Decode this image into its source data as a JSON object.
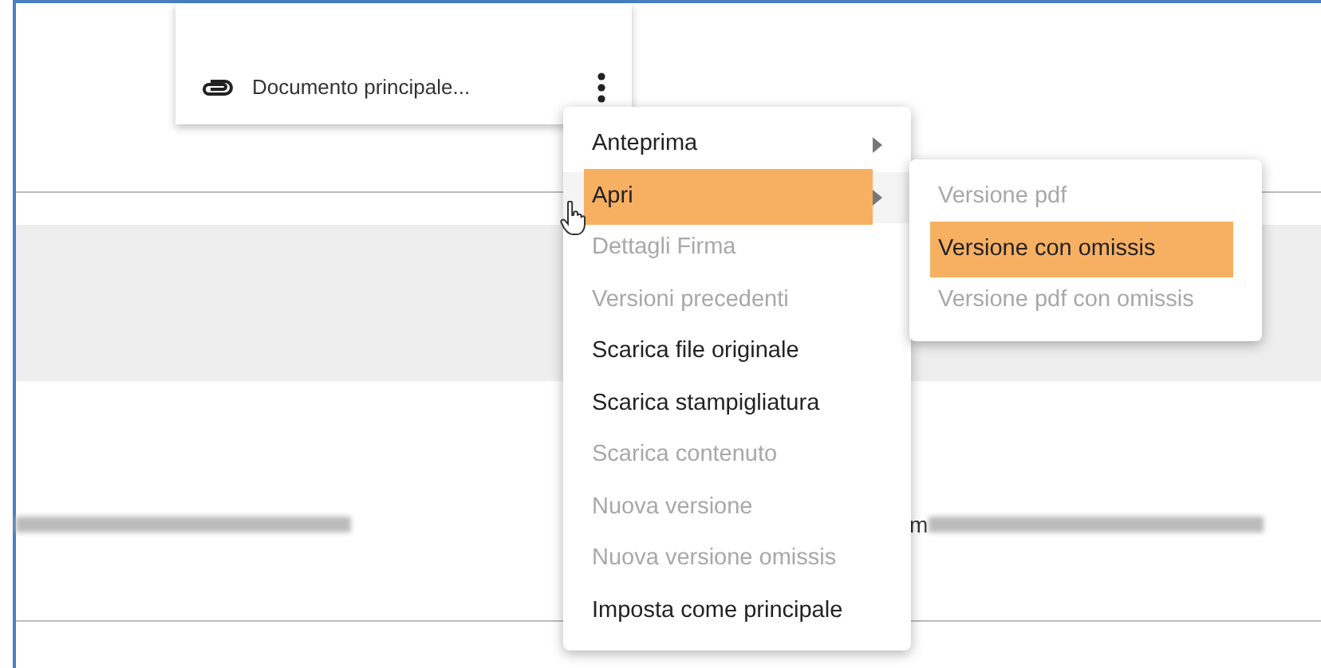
{
  "attachment_card": {
    "filename": "Documento principale..."
  },
  "context_menu": {
    "items": [
      {
        "label": "Anteprima",
        "submenu": true,
        "disabled": false,
        "selected": false
      },
      {
        "label": "Apri",
        "submenu": true,
        "disabled": false,
        "selected": true
      },
      {
        "label": "Dettagli Firma",
        "submenu": false,
        "disabled": true,
        "selected": false
      },
      {
        "label": "Versioni precedenti",
        "submenu": false,
        "disabled": true,
        "selected": false
      },
      {
        "label": "Scarica file originale",
        "submenu": false,
        "disabled": false,
        "selected": false
      },
      {
        "label": "Scarica stampigliatura",
        "submenu": false,
        "disabled": false,
        "selected": false
      },
      {
        "label": "Scarica contenuto",
        "submenu": false,
        "disabled": true,
        "selected": false
      },
      {
        "label": "Nuova versione",
        "submenu": false,
        "disabled": true,
        "selected": false
      },
      {
        "label": "Nuova versione omissis",
        "submenu": false,
        "disabled": true,
        "selected": false
      },
      {
        "label": "Imposta come principale",
        "submenu": false,
        "disabled": false,
        "selected": false
      }
    ]
  },
  "submenu": {
    "items": [
      {
        "label": "Versione pdf",
        "disabled": true,
        "selected": false
      },
      {
        "label": "Versione con omissis",
        "disabled": false,
        "selected": true
      },
      {
        "label": "Versione pdf con omissis",
        "disabled": true,
        "selected": false
      }
    ]
  },
  "table_row": {
    "fragment": "m"
  }
}
